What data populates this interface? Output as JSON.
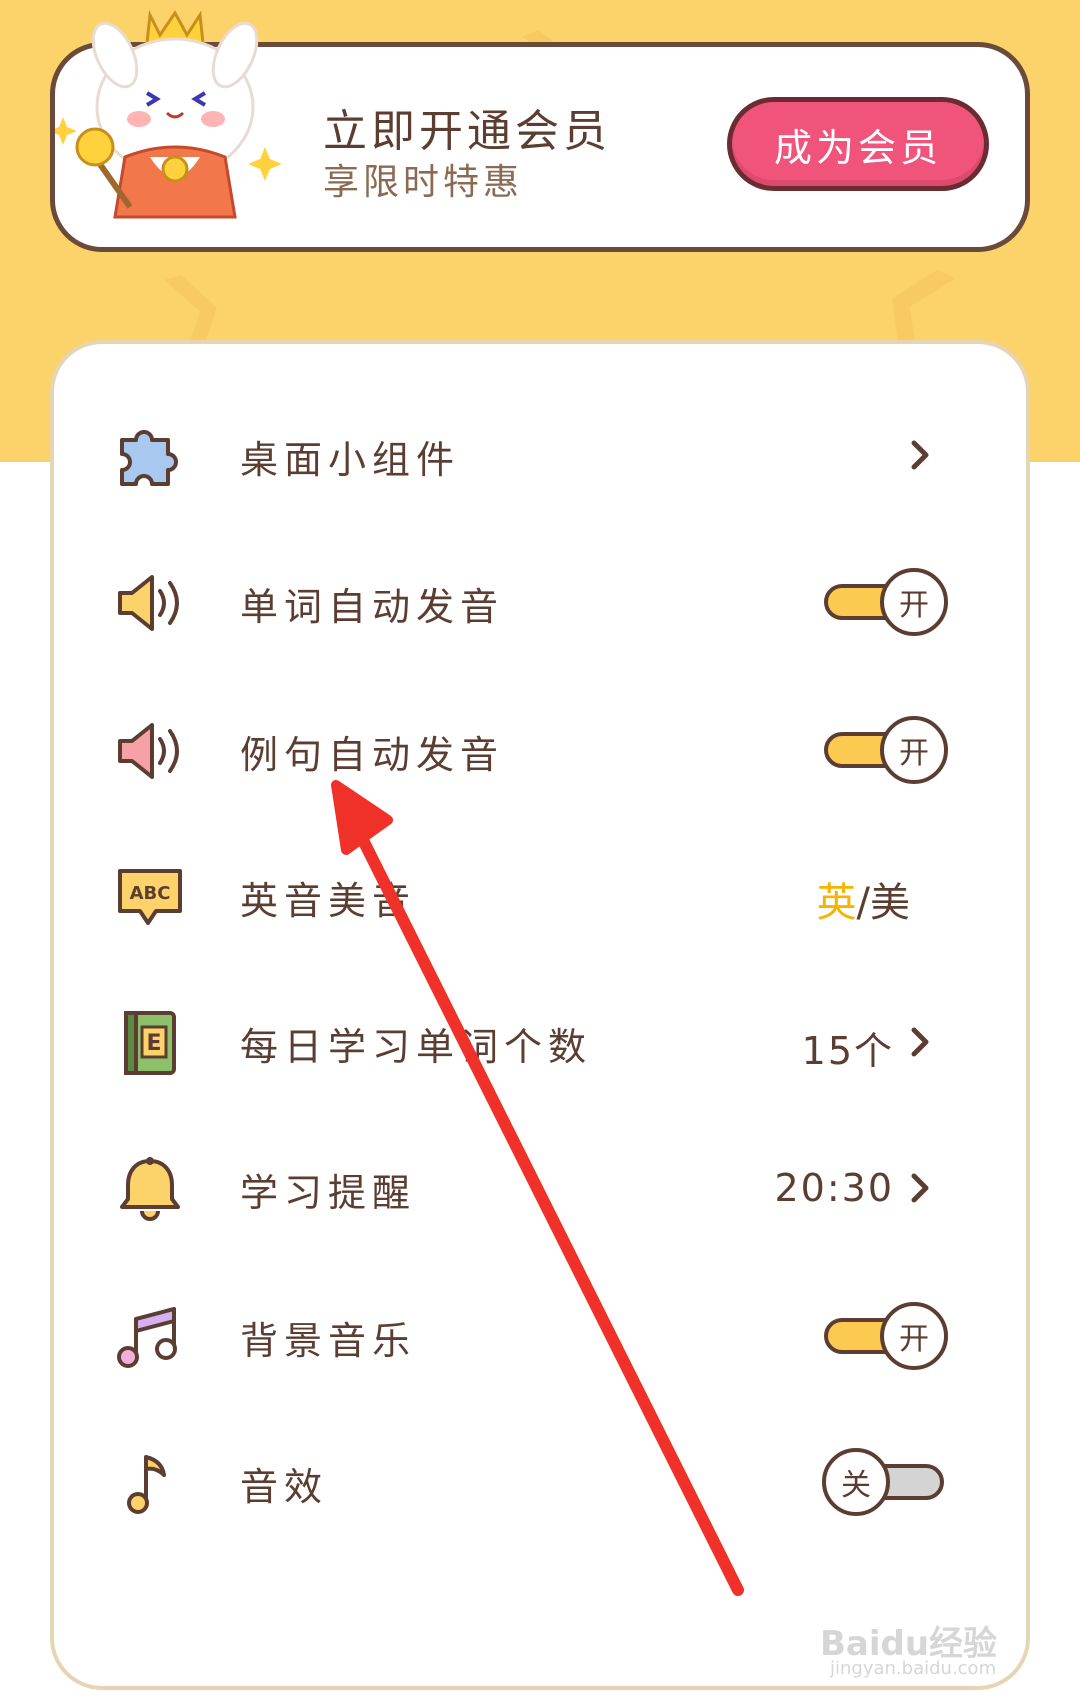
{
  "colors": {
    "header_bg": "#fcd26b",
    "text_brown": "#5b3e31",
    "accent_pink": "#f0547a",
    "toggle_on": "#fcca50",
    "toggle_off": "#d4d4d4",
    "selected_accent": "#f5b400",
    "annotation_arrow": "#f0312a"
  },
  "member_banner": {
    "title": "立即开通会员",
    "subtitle": "享限时特惠",
    "button_label": "成为会员",
    "mascot": "crowned-rabbit-mascot"
  },
  "settings": [
    {
      "id": "widget",
      "icon": "puzzle-icon",
      "label": "桌面小组件",
      "control": "chevron"
    },
    {
      "id": "word-auto-pronounce",
      "icon": "speaker-icon",
      "label": "单词自动发音",
      "control": "toggle",
      "state": "开"
    },
    {
      "id": "sentence-auto-pronounce",
      "icon": "speaker-pink-icon",
      "label": "例句自动发音",
      "control": "toggle",
      "state": "开"
    },
    {
      "id": "accent",
      "icon": "abc-speech-bubble-icon",
      "label": "英音美音",
      "control": "accent",
      "selected": "英",
      "separator": "/",
      "other": "美"
    },
    {
      "id": "daily-words",
      "icon": "book-e-icon",
      "label": "每日学习单词个数",
      "control": "value",
      "value": "15个"
    },
    {
      "id": "study-reminder",
      "icon": "bell-icon",
      "label": "学习提醒",
      "control": "value",
      "value": "20:30"
    },
    {
      "id": "bg-music",
      "icon": "music-notes-icon",
      "label": "背景音乐",
      "control": "toggle",
      "state": "开"
    },
    {
      "id": "sound-effects",
      "icon": "music-note-icon",
      "label": "音效",
      "control": "toggle",
      "state": "关"
    }
  ],
  "watermark": {
    "brand": "Baidu经验",
    "url": "jingyan.baidu.com"
  }
}
